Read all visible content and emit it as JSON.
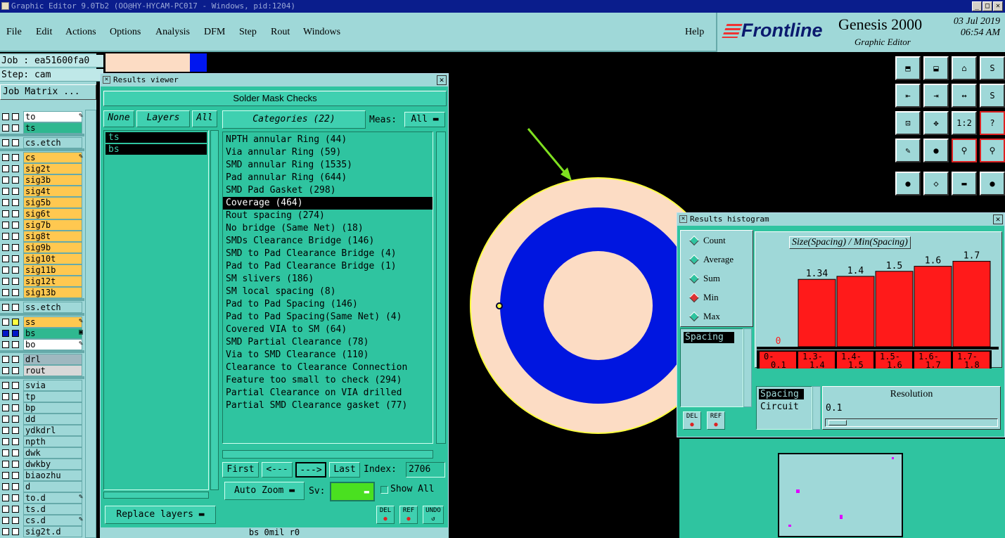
{
  "window": {
    "title": "Graphic Editor 9.0Tb2 (OO@HY-HYCAM-PC017 - Windows, pid:1204)",
    "minimize": "_",
    "restore": "□",
    "close": "✕"
  },
  "menu": {
    "items": [
      "File",
      "Edit",
      "Actions",
      "Options",
      "Analysis",
      "DFM",
      "Step",
      "Rout",
      "Windows"
    ],
    "help": "Help"
  },
  "brand": {
    "logo": "Frontline",
    "product": "Genesis 2000",
    "subtitle": "Graphic Editor",
    "date": "03 Jul 2019",
    "time": "06:54 AM"
  },
  "job": {
    "job_line": "Job : ea51600fa0",
    "step_line": "Step: cam",
    "matrix_button": "Job Matrix ..."
  },
  "layers": [
    {
      "name": "to",
      "color": "#ffffff",
      "mark": "✎"
    },
    {
      "name": "ts",
      "color": "#2fb890",
      "mark": ""
    },
    {
      "name": "cs.etch",
      "color": "#9fd8d8",
      "mark": ""
    },
    {
      "name": "cs",
      "color": "#ffc850",
      "mark": "✎"
    },
    {
      "name": "sig2t",
      "color": "#ffc850",
      "mark": ""
    },
    {
      "name": "sig3b",
      "color": "#ffc850",
      "mark": ""
    },
    {
      "name": "sig4t",
      "color": "#ffc850",
      "mark": ""
    },
    {
      "name": "sig5b",
      "color": "#ffc850",
      "mark": ""
    },
    {
      "name": "sig6t",
      "color": "#ffc850",
      "mark": ""
    },
    {
      "name": "sig7b",
      "color": "#ffc850",
      "mark": ""
    },
    {
      "name": "sig8t",
      "color": "#ffc850",
      "mark": ""
    },
    {
      "name": "sig9b",
      "color": "#ffc850",
      "mark": ""
    },
    {
      "name": "sig10t",
      "color": "#ffc850",
      "mark": ""
    },
    {
      "name": "sig11b",
      "color": "#ffc850",
      "mark": ""
    },
    {
      "name": "sig12t",
      "color": "#ffc850",
      "mark": ""
    },
    {
      "name": "sig13b",
      "color": "#ffc850",
      "mark": ""
    },
    {
      "name": "ss.etch",
      "color": "#9fd8d8",
      "mark": ""
    },
    {
      "name": "ss",
      "color": "#ffc850",
      "mark": "✎"
    },
    {
      "name": "bs",
      "color": "#2fb890",
      "mark": "▣"
    },
    {
      "name": "bo",
      "color": "#ffffff",
      "mark": "✎"
    },
    {
      "name": "drl",
      "color": "#9fb8c0",
      "mark": ""
    },
    {
      "name": "rout",
      "color": "#d8d8d8",
      "mark": ""
    },
    {
      "name": "svia",
      "color": "#9fd8d8",
      "mark": ""
    },
    {
      "name": "tp",
      "color": "#9fd8d8",
      "mark": ""
    },
    {
      "name": "bp",
      "color": "#9fd8d8",
      "mark": ""
    },
    {
      "name": "dd",
      "color": "#9fd8d8",
      "mark": ""
    },
    {
      "name": "ydkdrl",
      "color": "#9fd8d8",
      "mark": ""
    },
    {
      "name": "npth",
      "color": "#9fd8d8",
      "mark": ""
    },
    {
      "name": "dwk",
      "color": "#9fd8d8",
      "mark": ""
    },
    {
      "name": "dwkby",
      "color": "#9fd8d8",
      "mark": ""
    },
    {
      "name": "biaozhu",
      "color": "#9fd8d8",
      "mark": ""
    },
    {
      "name": "d",
      "color": "#9fd8d8",
      "mark": ""
    },
    {
      "name": "to.d",
      "color": "#9fd8d8",
      "mark": "✎"
    },
    {
      "name": "ts.d",
      "color": "#9fd8d8",
      "mark": ""
    },
    {
      "name": "cs.d",
      "color": "#9fd8d8",
      "mark": "✎"
    },
    {
      "name": "sig2t.d",
      "color": "#9fd8d8",
      "mark": ""
    }
  ],
  "results_viewer": {
    "title": "Results viewer",
    "close": "✕",
    "header": "Solder Mask Checks",
    "none_button": "None",
    "layers_button": "Layers",
    "all_button": "All",
    "layer_list": [
      "ts",
      "bs"
    ],
    "categories_button": "Categories (22)",
    "meas_label": "Meas:",
    "meas_value": "All",
    "categories": [
      "NPTH annular Ring (44)",
      "Via annular Ring (59)",
      "SMD annular Ring (1535)",
      "Pad annular Ring (644)",
      "SMD Pad Gasket (298)",
      "Coverage (464)",
      "Rout spacing (274)",
      "No bridge (Same Net) (18)",
      "SMDs Clearance Bridge (146)",
      "SMD to Pad Clearance Bridge (4)",
      "Pad to Pad Clearance Bridge (1)",
      "SM slivers (186)",
      "SM local spacing (8)",
      "Pad to Pad Spacing (146)",
      "Pad to Pad Spacing(Same Net) (4)",
      "Covered VIA to SM (64)",
      "SMD Partial Clearance (78)",
      "Via to SMD Clearance (110)",
      "Clearance to Clearance Connection",
      "Feature too small to check (294)",
      "Partial Clearance on VIA drilled",
      "Partial SMD Clearance gasket (77)"
    ],
    "selected_category_index": 5,
    "first_button": "First",
    "prev_button": "<---",
    "next_button": "--->",
    "last_button": "Last",
    "index_label": "Index:",
    "index_value": "2706",
    "replace_layers": "Replace layers",
    "auto_zoom": "Auto Zoom",
    "sv_label": "Sv:",
    "show_all": "Show All",
    "del": "DEL",
    "ref": "REF",
    "undo": "UNDO",
    "status": "bs 0mil  r0"
  },
  "histogram": {
    "title": "Results histogram",
    "close": "✕",
    "modes": [
      "Count",
      "Average",
      "Sum",
      "Min",
      "Max"
    ],
    "selected_mode": "Min",
    "chart_title": "Size(Spacing) / Min(Spacing)",
    "metric_list": [
      "Spacing"
    ],
    "del": "DEL",
    "ref": "REF",
    "param_list": [
      "Spacing",
      "Circuit"
    ],
    "resolution_label": "Resolution",
    "resolution_value": "0.1"
  },
  "chart_data": {
    "type": "bar",
    "title": "Size(Spacing) / Min(Spacing)",
    "categories": [
      "0-0.1",
      "1.3-1.4",
      "1.4-1.5",
      "1.5-1.6",
      "1.6-1.7",
      "1.7-1.8"
    ],
    "category_labels": [
      [
        "0-",
        "0.1"
      ],
      [
        "1.3-",
        "1.4"
      ],
      [
        "1.4-",
        "1.5"
      ],
      [
        "1.5-",
        "1.6"
      ],
      [
        "1.6-",
        "1.7"
      ],
      [
        "1.7-",
        "1.8"
      ]
    ],
    "values": [
      0,
      1.34,
      1.4,
      1.5,
      1.6,
      1.7
    ],
    "value_labels": [
      "0",
      "1.34",
      "1.4",
      "1.5",
      "1.6",
      "1.7"
    ],
    "ylim": [
      0,
      2.0
    ],
    "bar_color": "#ff1a1a",
    "grid": false
  },
  "tools": [
    "top-icon",
    "down-icon",
    "home-icon",
    "s-icon",
    "left-icon",
    "right-icon",
    "swap-icon",
    "s2-icon",
    "fit-icon",
    "zoom-icon",
    "ratio-icon",
    "help-icon",
    "pencil-icon",
    "probe-icon",
    "net-icon",
    "net2-icon",
    "pad-icon",
    "shape-icon",
    "ruler-icon",
    "dot-icon"
  ],
  "tool_labels": [
    "⬒",
    "⬓",
    "⌂",
    "S",
    "⇤",
    "⇥",
    "↔",
    "S",
    "⊡",
    "✥",
    "1:2",
    "?",
    "✎",
    "●",
    "⚲",
    "⚲",
    "●",
    "◇",
    "▬",
    "●"
  ]
}
